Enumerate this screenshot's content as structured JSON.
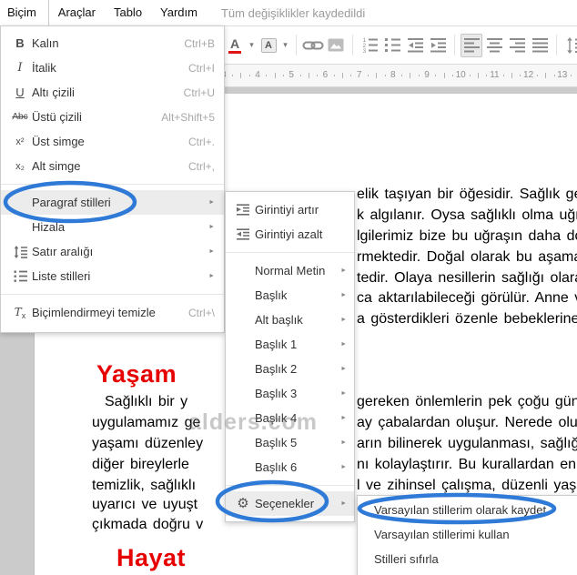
{
  "menubar": {
    "menus": [
      "Biçim",
      "Araçlar",
      "Tablo",
      "Yardım"
    ],
    "open_menu": "Biçim",
    "status": "Tüm değişiklikler kaydedildi"
  },
  "toolbar": {
    "items": [
      {
        "name": "text-color-icon",
        "icon": "text-color"
      },
      {
        "type": "dd",
        "name": "text-color-dropdown"
      },
      {
        "name": "highlight-color-icon",
        "icon": "highlight-color"
      },
      {
        "type": "dd",
        "name": "highlight-color-dropdown"
      },
      {
        "type": "sep"
      },
      {
        "name": "insert-link-icon",
        "icon": "insert-link"
      },
      {
        "name": "insert-image-icon",
        "icon": "insert-image"
      },
      {
        "type": "sep"
      },
      {
        "name": "numbered-list-icon",
        "icon": "numbered-list"
      },
      {
        "name": "bulleted-list-icon",
        "icon": "bulleted-list"
      },
      {
        "name": "decrease-indent-icon",
        "icon": "decrease-indent"
      },
      {
        "name": "increase-indent-icon",
        "icon": "increase-indent"
      },
      {
        "type": "sep"
      },
      {
        "name": "align-left-icon",
        "icon": "align-left",
        "selected": true
      },
      {
        "name": "align-center-icon",
        "icon": "align-center"
      },
      {
        "name": "align-right-icon",
        "icon": "align-right"
      },
      {
        "name": "align-justify-icon",
        "icon": "align-justify"
      },
      {
        "type": "sep"
      },
      {
        "name": "line-spacing-icon",
        "icon": "line-spacing-lg"
      }
    ]
  },
  "ruler": {
    "numbers": [
      3,
      4,
      5,
      6,
      7,
      8,
      9,
      10,
      11,
      12,
      13
    ]
  },
  "format_menu": {
    "items": [
      {
        "icon": "bold-icon",
        "label": "Kalın",
        "shortcut": "Ctrl+B"
      },
      {
        "icon": "italic-icon",
        "label": "İtalik",
        "shortcut": "Ctrl+I"
      },
      {
        "icon": "underline-icon",
        "label": "Altı çizili",
        "shortcut": "Ctrl+U"
      },
      {
        "icon": "strikethrough-icon",
        "label": "Üstü çizili",
        "shortcut": "Alt+Shift+5"
      },
      {
        "icon": "superscript-icon",
        "label": "Üst simge",
        "shortcut": "Ctrl+."
      },
      {
        "icon": "subscript-icon",
        "label": "Alt simge",
        "shortcut": "Ctrl+,"
      },
      {
        "separator": true
      },
      {
        "label": "Paragraf stilleri",
        "arrow": true,
        "highlight": true
      },
      {
        "label": "Hizala",
        "arrow": true
      },
      {
        "icon": "line-spacing-icon",
        "label": "Satır aralığı",
        "arrow": true
      },
      {
        "icon": "list-styles-icon",
        "label": "Liste stilleri",
        "arrow": true
      },
      {
        "separator": true
      },
      {
        "icon": "clear-formatting-icon",
        "label": "Biçimlendirmeyi temizle",
        "shortcut": "Ctrl+\\"
      }
    ]
  },
  "paragraph_styles_menu": {
    "items": [
      {
        "icon": "indent-increase-icon",
        "label": "Girintiyi artır"
      },
      {
        "icon": "indent-decrease-icon",
        "label": "Girintiyi azalt"
      },
      {
        "separator": true
      },
      {
        "label": "Normal Metin",
        "arrow": true
      },
      {
        "label": "Başlık",
        "arrow": true
      },
      {
        "label": "Alt başlık",
        "arrow": true
      },
      {
        "label": "Başlık 1",
        "arrow": true
      },
      {
        "label": "Başlık 2",
        "arrow": true
      },
      {
        "label": "Başlık 3",
        "arrow": true
      },
      {
        "label": "Başlık 4",
        "arrow": true
      },
      {
        "label": "Başlık 5",
        "arrow": true
      },
      {
        "label": "Başlık 6",
        "arrow": true
      },
      {
        "separator": true
      },
      {
        "icon": "gear-icon",
        "label": "Seçenekler",
        "arrow": true,
        "highlight": true
      }
    ]
  },
  "options_menu": {
    "items": [
      {
        "label": "Varsayılan stillerim olarak kaydet"
      },
      {
        "label": "Varsayılan stillerimi kullan"
      },
      {
        "label": "Stilleri sıfırla"
      }
    ]
  },
  "document": {
    "heading1": "Yaşam",
    "heading2": "Hayat",
    "paragraph1_fragments": [
      "elik taşıyan bir öğesidir. Sağlık gene",
      "k algılanır. Oysa sağlıklı olma uğrund",
      "lgilerimiz bize bu uğraşın daha doğr",
      "rmektedir. Doğal olarak bu aşamad",
      "tedir. Olaya nesillerin sağlığı olarak",
      "ca aktarılabileceği görülür. Anne ve",
      "a gösterdikleri özenle bebeklerine s"
    ],
    "paragraph2_left": [
      "Sağlıklı bir y",
      "uygulamamız ge",
      "yaşamı düzenley",
      "diğer bireylerle",
      "temizlik, sağlıklı",
      "uyarıcı ve uyuşt",
      "çıkmada doğru v"
    ],
    "paragraph2_right": [
      "gereken önlemlerin pek çoğu gün",
      "ay çabalardan oluşur. Nerede olu",
      "arın bilinerek uygulanması, sağlığı",
      "nı kolaylaştırır. Bu kurallardan en",
      "l ve zihinsel çalışma, düzenli yaşa"
    ],
    "watermark": "alders.com"
  },
  "colors": {
    "annotation_blue": "#2f7ad7",
    "heading_red": "#e60000",
    "text_color_indicator": "#e01414"
  }
}
